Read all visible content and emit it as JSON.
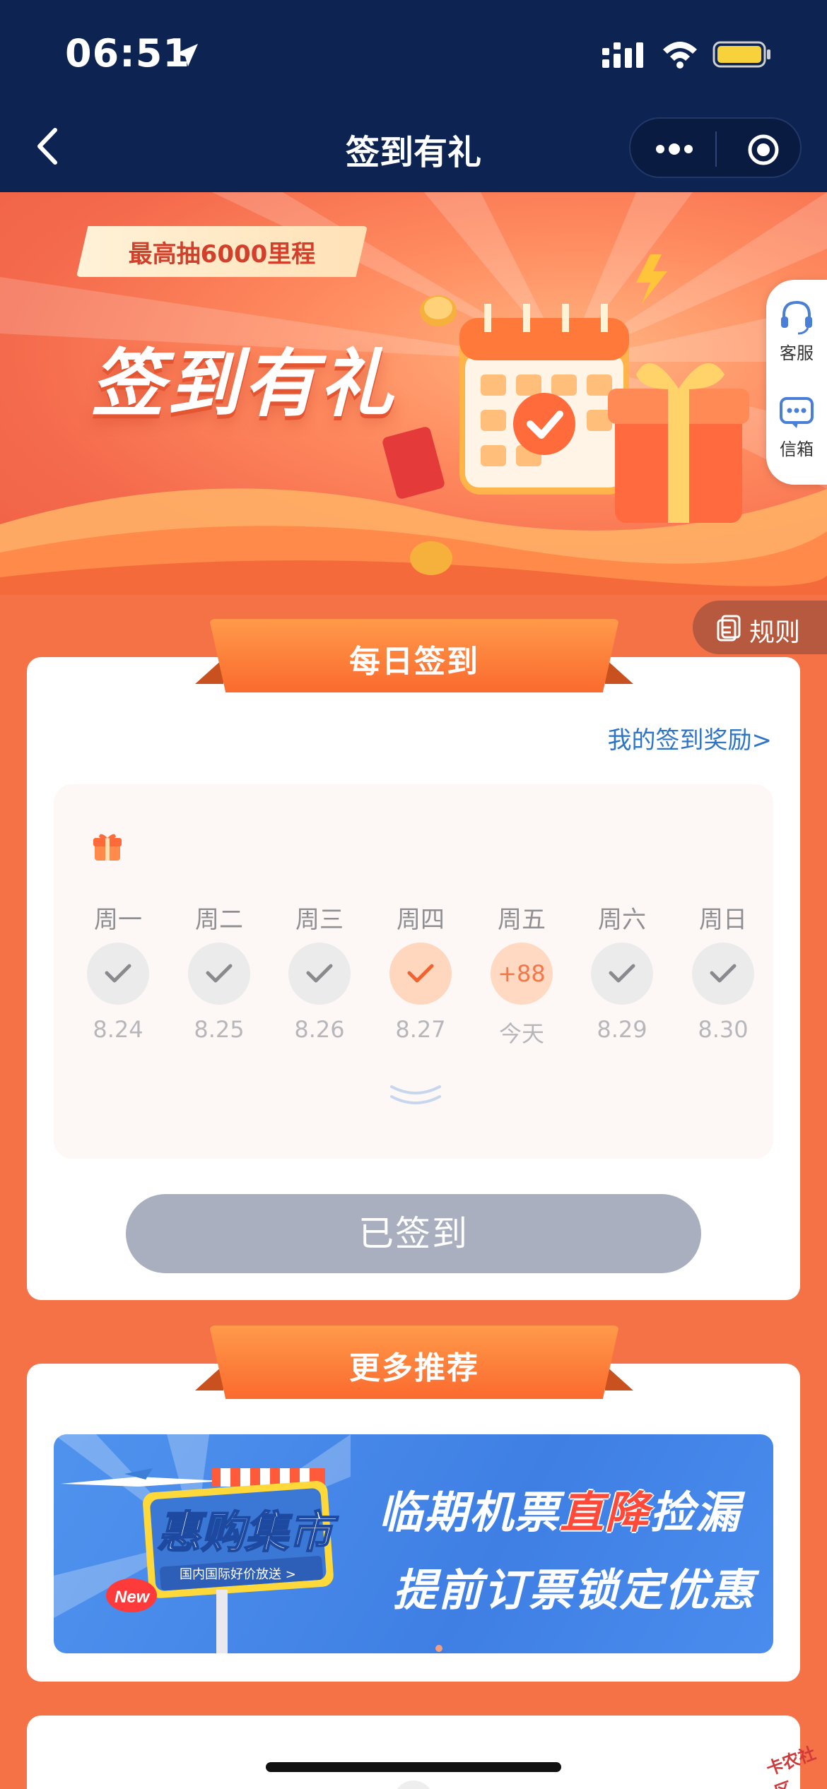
{
  "status_bar": {
    "time": "06:51"
  },
  "nav": {
    "title": "签到有礼"
  },
  "banner": {
    "title": "签到有礼",
    "subtitle": "最高抽6000里程"
  },
  "side_float": {
    "service_label": "客服",
    "mailbox_label": "信箱"
  },
  "rules": {
    "label": "规则"
  },
  "daily_checkin": {
    "section_title": "每日签到",
    "rewards_link": "我的签到奖励>",
    "days": [
      {
        "weekday": "周一",
        "date": "8.24",
        "state": "checked"
      },
      {
        "weekday": "周二",
        "date": "8.25",
        "state": "checked"
      },
      {
        "weekday": "周三",
        "date": "8.26",
        "state": "checked"
      },
      {
        "weekday": "周四",
        "date": "8.27",
        "state": "checked-highlight"
      },
      {
        "weekday": "周五",
        "date": "今天",
        "state": "bonus",
        "bonus": "+88"
      },
      {
        "weekday": "周六",
        "date": "8.29",
        "state": "checked"
      },
      {
        "weekday": "周日",
        "date": "8.30",
        "state": "checked"
      }
    ],
    "button_label": "已签到"
  },
  "more": {
    "section_title": "更多推荐",
    "promo": {
      "line1_a": "临期机票",
      "line1_highlight": "直降",
      "line1_b": "捡漏",
      "line2": "提前订票锁定优惠",
      "sign_text": "惠购集市",
      "sign_sub": "国内国际好价放送 >",
      "new_badge": "New"
    }
  },
  "watermark": "卡农社区",
  "colors": {
    "nav_bg": "#0d2352",
    "page_bg": "#f57247",
    "accent_orange": "#fb6a2e",
    "link_blue": "#2e74c8",
    "button_disabled": "#a9afbe"
  }
}
